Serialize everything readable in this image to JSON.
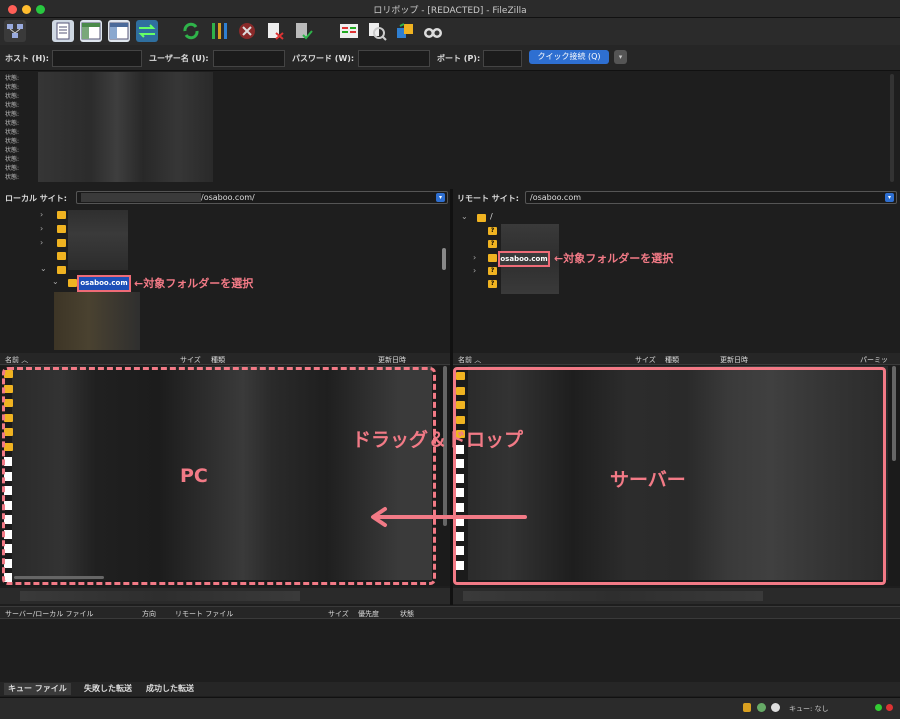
{
  "window": {
    "title": "ロリポップ - [REDACTED] - FileZilla"
  },
  "quickconnect": {
    "host_label": "ホスト (H):",
    "user_label": "ユーザー名 (U):",
    "password_label": "パスワード (W):",
    "port_label": "ポート (P):",
    "connect_button": "クイック接続 (Q)",
    "dropdown": "▾"
  },
  "log": {
    "line": "状態:"
  },
  "local": {
    "site_label": "ローカル サイト:",
    "path": "/osaboo.com/",
    "selected_folder": "osaboo.com",
    "columns": [
      "名前",
      "サイズ",
      "種類",
      "更新日時"
    ]
  },
  "remote": {
    "site_label": "リモート サイト:",
    "path": "/osaboo.com",
    "root": "/",
    "selected_folder": "osaboo.com",
    "columns": [
      "名前",
      "サイズ",
      "種類",
      "更新日時",
      "パーミッ"
    ]
  },
  "annotations": {
    "select_local": "←対象フォルダーを選択",
    "select_remote": "←対象フォルダーを選択",
    "drag_drop": "ドラッグ＆ドロップ",
    "pc": "PC",
    "server": "サーバー",
    "color": "#f27a86"
  },
  "queue": {
    "columns": [
      "サーバー/ローカル ファイル",
      "方向",
      "リモート ファイル",
      "サイズ",
      "優先度",
      "状態"
    ],
    "tabs": [
      "キュー ファイル",
      "失敗した転送",
      "成功した転送"
    ],
    "status": "キュー: なし"
  }
}
